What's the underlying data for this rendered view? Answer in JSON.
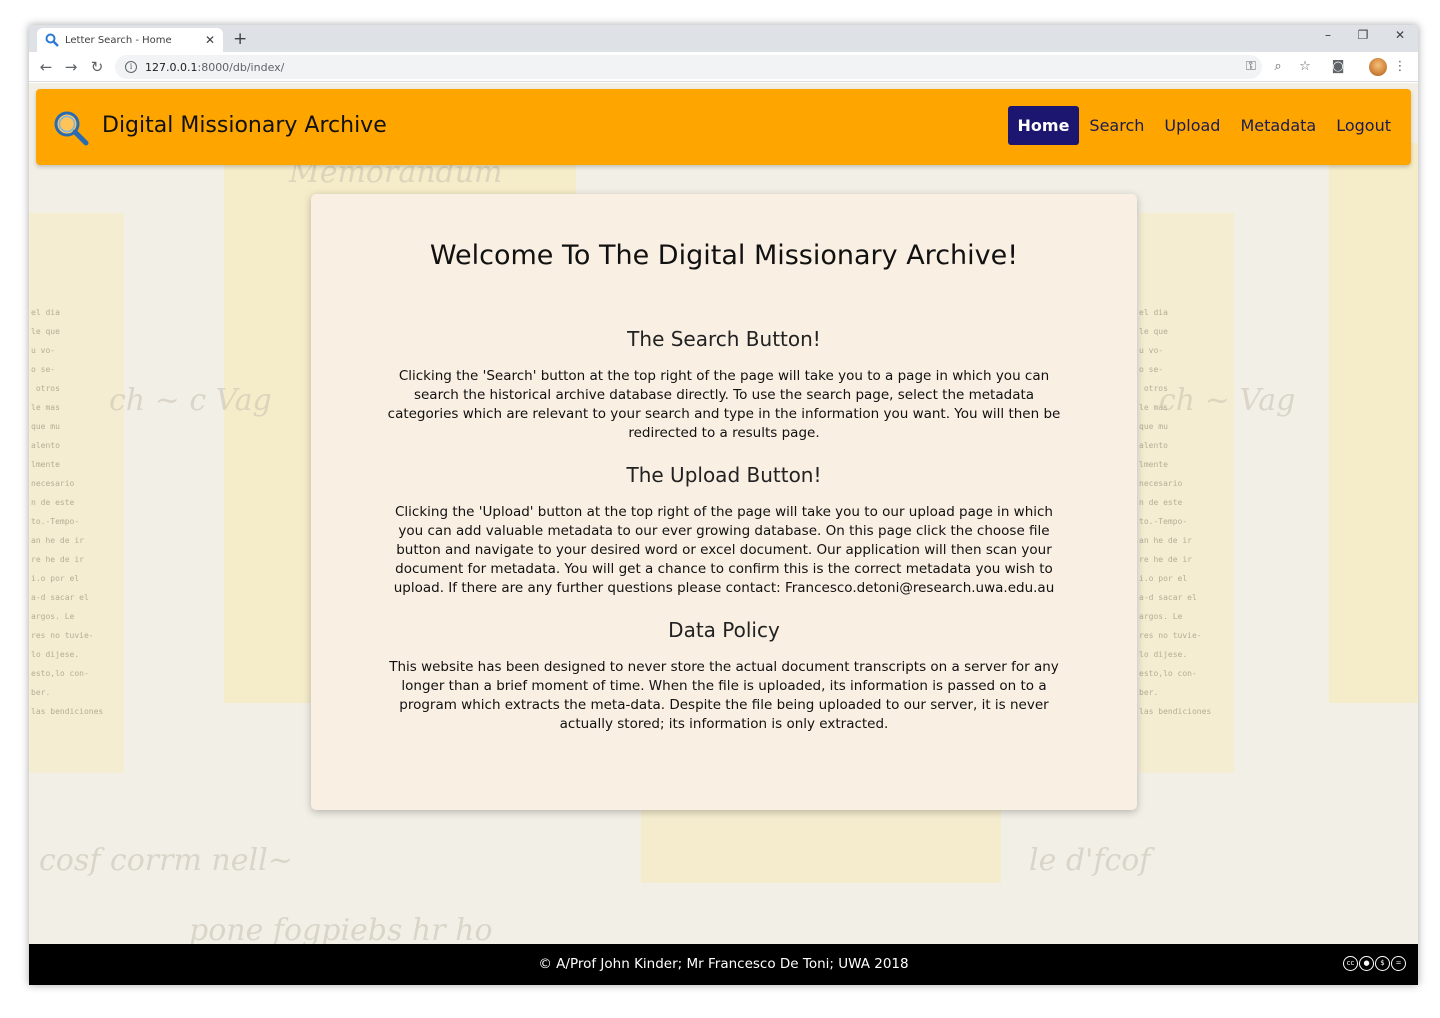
{
  "browser": {
    "tab_title": "Letter Search - Home",
    "tab_close": "✕",
    "new_tab": "+",
    "url_host": "127.0.0.1",
    "url_path": ":8000/db/index/",
    "window_controls": [
      "–",
      "❐",
      "✕"
    ],
    "nav_icons": [
      "back-arrow-icon",
      "forward-arrow-icon",
      "reload-icon"
    ],
    "toolbar_icons": [
      "key-icon",
      "zoom-icon",
      "star-icon",
      "camera-icon",
      "avatar-icon",
      "menu-icon"
    ]
  },
  "navbar": {
    "brand": "Digital Missionary Archive",
    "items": [
      {
        "label": "Home",
        "active": true
      },
      {
        "label": "Search",
        "active": false
      },
      {
        "label": "Upload",
        "active": false
      },
      {
        "label": "Metadata",
        "active": false
      },
      {
        "label": "Logout",
        "active": false
      }
    ]
  },
  "content": {
    "title": "Welcome To The Digital Missionary Archive!",
    "sections": [
      {
        "heading": "The Search Button!",
        "body": "Clicking the 'Search' button at the top right of the page will take you to a page in which you can search the historical archive database directly. To use the search page, select the metadata categories which are relevant to your search and type in the information you want. You will then be redirected to a results page."
      },
      {
        "heading": "The Upload Button!",
        "body": "Clicking the 'Upload' button at the top right of the page will take you to our upload page in which you can add valuable metadata to our ever growing database. On this page click the choose file button and navigate to your desired word or excel document. Our application will then scan your document for metadata. You will get a chance to confirm this is the correct metadata you wish to upload. If there are any further questions please contact: Francesco.detoni@research.uwa.edu.au"
      },
      {
        "heading": "Data Policy",
        "body": "This website has been designed to never store the actual document transcripts on a server for any longer than a brief moment of time. When the file is uploaded, its information is passed on to a program which extracts the meta-data. Despite the file being uploaded to our server, it is never actually stored; its information is only extracted."
      }
    ]
  },
  "footer": {
    "copyright": "© A/Prof John Kinder; Mr Francesco De Toni; UWA 2018",
    "license_icons": [
      "cc",
      "by",
      "nc",
      "nd"
    ]
  },
  "colors": {
    "navbar": "#ffa500",
    "active_nav": "#1c1670",
    "card": "#f9efe3",
    "footer": "#000000"
  }
}
